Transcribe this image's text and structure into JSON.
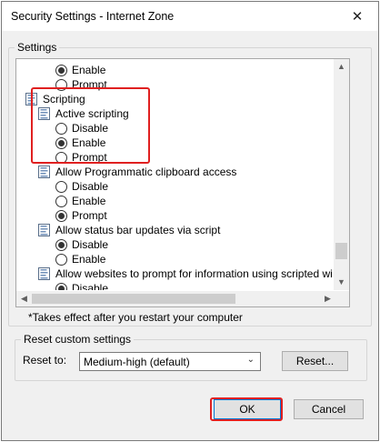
{
  "window": {
    "title": "Security Settings - Internet Zone",
    "close_glyph": "✕"
  },
  "settings": {
    "group_label": "Settings",
    "tree": [
      {
        "kind": "radio",
        "checked": true,
        "label": "Enable"
      },
      {
        "kind": "radio",
        "checked": false,
        "label": "Prompt"
      },
      {
        "kind": "category",
        "label": "Scripting"
      },
      {
        "kind": "setting",
        "label": "Active scripting"
      },
      {
        "kind": "radio",
        "checked": false,
        "label": "Disable"
      },
      {
        "kind": "radio",
        "checked": true,
        "label": "Enable"
      },
      {
        "kind": "radio",
        "checked": false,
        "label": "Prompt"
      },
      {
        "kind": "setting",
        "label": "Allow Programmatic clipboard access"
      },
      {
        "kind": "radio",
        "checked": false,
        "label": "Disable"
      },
      {
        "kind": "radio",
        "checked": false,
        "label": "Enable"
      },
      {
        "kind": "radio",
        "checked": true,
        "label": "Prompt"
      },
      {
        "kind": "setting",
        "label": "Allow status bar updates via script"
      },
      {
        "kind": "radio",
        "checked": true,
        "label": "Disable"
      },
      {
        "kind": "radio",
        "checked": false,
        "label": "Enable"
      },
      {
        "kind": "setting",
        "label": "Allow websites to prompt for information using scripted windo"
      },
      {
        "kind": "radio",
        "checked": true,
        "label": "Disable"
      }
    ],
    "note": "*Takes effect after you restart your computer"
  },
  "reset": {
    "group_label": "Reset custom settings",
    "reset_to_label": "Reset to:",
    "selected_level": "Medium-high (default)",
    "reset_button": "Reset..."
  },
  "footer": {
    "ok_label": "OK",
    "cancel_label": "Cancel"
  },
  "colors": {
    "highlight": "#e02020",
    "accent": "#0078d7"
  }
}
